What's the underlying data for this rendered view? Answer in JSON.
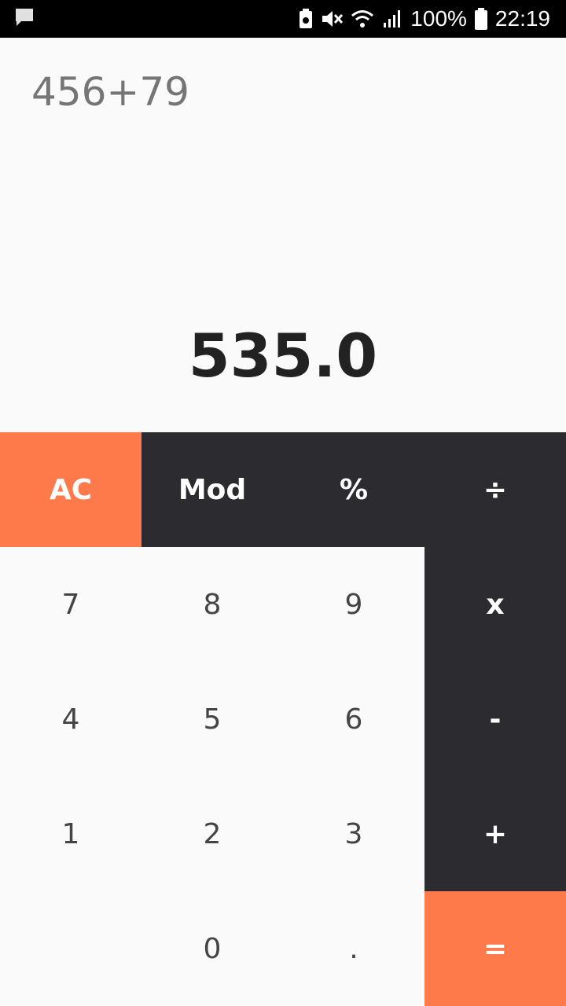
{
  "status_bar": {
    "battery_percent": "100%",
    "time": "22:19",
    "icons": [
      "message-icon",
      "battery-saver-icon",
      "mute-icon",
      "wifi-icon",
      "signal-icon",
      "battery-icon"
    ]
  },
  "display": {
    "expression": "456+79",
    "result": "535.0"
  },
  "keys": {
    "ac": "AC",
    "mod": "Mod",
    "percent": "%",
    "divide": "÷",
    "seven": "7",
    "eight": "8",
    "nine": "9",
    "multiply": "x",
    "four": "4",
    "five": "5",
    "six": "6",
    "minus": "-",
    "one": "1",
    "two": "2",
    "three": "3",
    "plus": "+",
    "zero": "0",
    "dot": ".",
    "equals": "="
  },
  "colors": {
    "accent": "#ff7a4a",
    "dark": "#2b2b30",
    "background": "#fafafa"
  }
}
